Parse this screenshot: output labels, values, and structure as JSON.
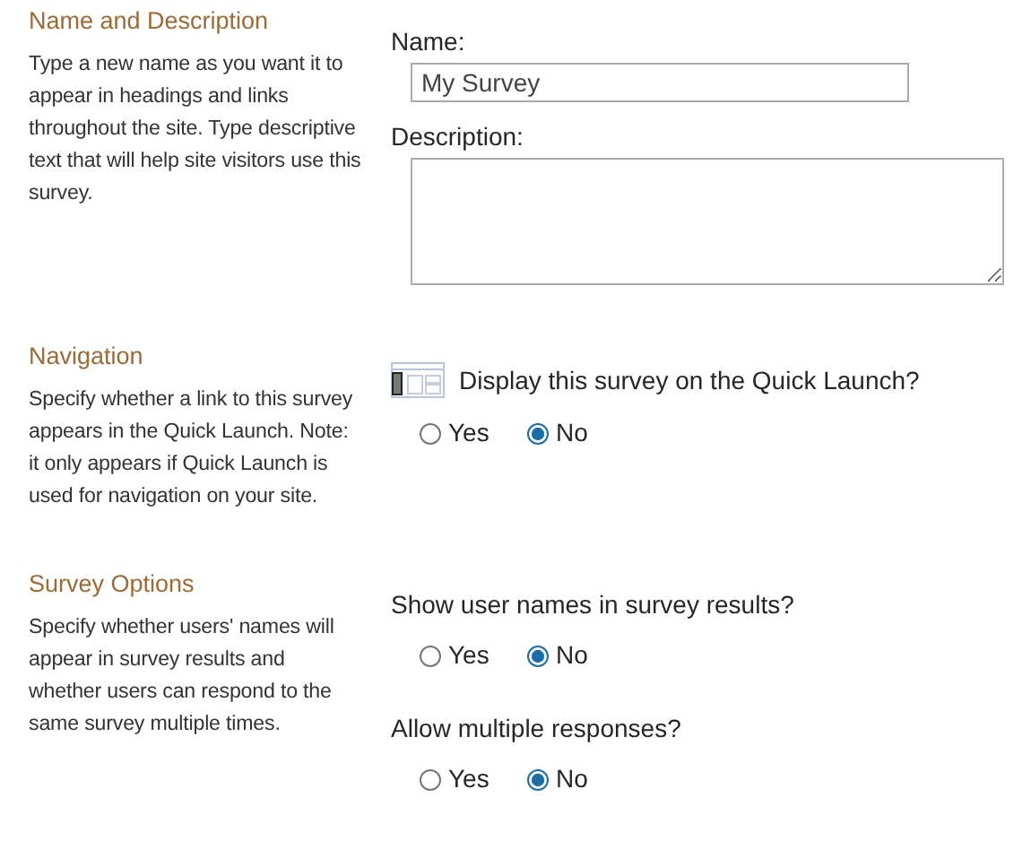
{
  "sections": [
    {
      "title": "Name and Description",
      "description": "Type a new name as you want it to appear in headings and links throughout the site. Type descriptive text that will help site visitors use this survey.",
      "fields": [
        {
          "kind": "text",
          "label": "Name:",
          "value": "My Survey"
        },
        {
          "kind": "textarea",
          "label": "Description:"
        }
      ]
    },
    {
      "title": "Navigation",
      "description": "Specify whether a link to this survey appears in the Quick Launch. Note: it only appears if Quick Launch is used for navigation on your site.",
      "fields": [
        {
          "kind": "radio",
          "icon": true,
          "label": "Display this survey on the Quick Launch?",
          "options": [
            {
              "label": "Yes",
              "selected": false
            },
            {
              "label": "No",
              "selected": true
            }
          ]
        }
      ]
    },
    {
      "title": "Survey Options",
      "description": "Specify whether users' names will appear in survey results and whether users can respond to the same survey multiple times.",
      "fields": [
        {
          "kind": "radio",
          "label": "Show user names in survey results?",
          "options": [
            {
              "label": "Yes",
              "selected": false
            },
            {
              "label": "No",
              "selected": true
            }
          ]
        },
        {
          "kind": "radio",
          "label": "Allow multiple responses?",
          "options": [
            {
              "label": "Yes",
              "selected": false
            },
            {
              "label": "No",
              "selected": true
            }
          ]
        }
      ]
    }
  ]
}
